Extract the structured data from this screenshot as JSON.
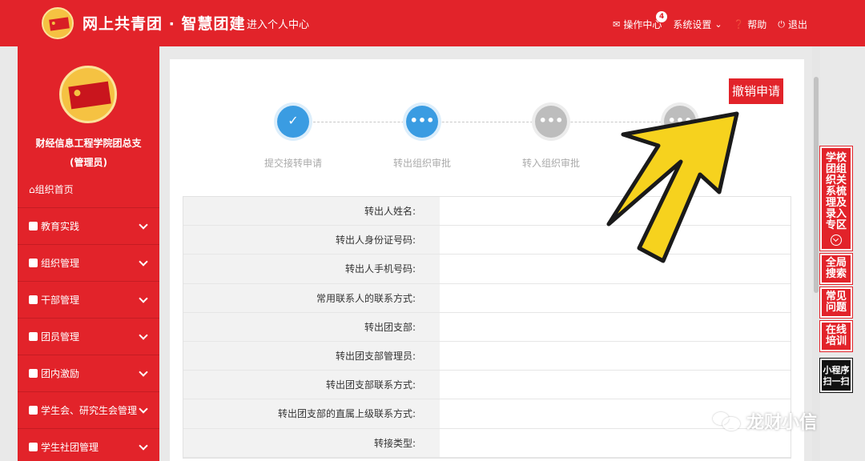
{
  "header": {
    "brand": "网上共青团 · 智慧团建",
    "enter_center": "进入个人中心",
    "nav": {
      "ops": "操作中心",
      "ops_badge": "4",
      "settings": "系统设置",
      "help": "帮助",
      "logout": "退出"
    }
  },
  "sidebar": {
    "org_name": "财经信息工程学院团总支",
    "org_role": "(管理员)",
    "home": "组织首页",
    "items": [
      {
        "label": "教育实践"
      },
      {
        "label": "组织管理"
      },
      {
        "label": "干部管理"
      },
      {
        "label": "团员管理"
      },
      {
        "label": "团内激励"
      },
      {
        "label": "学生会、研究生会管理"
      },
      {
        "label": "学生社团管理"
      }
    ]
  },
  "main": {
    "cancel_button": "撤销申请",
    "steps": [
      {
        "label": "提交接转申请",
        "state": "done"
      },
      {
        "label": "转出组织审批",
        "state": "active"
      },
      {
        "label": "转入组织审批",
        "state": "todo"
      },
      {
        "label": "",
        "state": "todo"
      }
    ],
    "form_rows": [
      {
        "label": "转出人姓名:",
        "value": ""
      },
      {
        "label": "转出人身份证号码:",
        "value": ""
      },
      {
        "label": "转出人手机号码:",
        "value": ""
      },
      {
        "label": "常用联系人的联系方式:",
        "value": ""
      },
      {
        "label": "转出团支部:",
        "value": ""
      },
      {
        "label": "转出团支部管理员:",
        "value": ""
      },
      {
        "label": "转出团支部联系方式:",
        "value": ""
      },
      {
        "label": "转出团支部的直属上级联系方式:",
        "value": ""
      },
      {
        "label": "转接类型:",
        "value": ""
      }
    ]
  },
  "right_float": {
    "zone": "学校团组织关系梳理及录入专区",
    "search": "全局搜索",
    "faq": "常见问题",
    "training": "在线培训",
    "miniapp": "小程序扫一扫"
  },
  "watermark": "龙财小信",
  "colors": {
    "brand_red": "#e2232a",
    "step_blue": "#3a9ce2",
    "arrow_yellow": "#f6d21e"
  }
}
